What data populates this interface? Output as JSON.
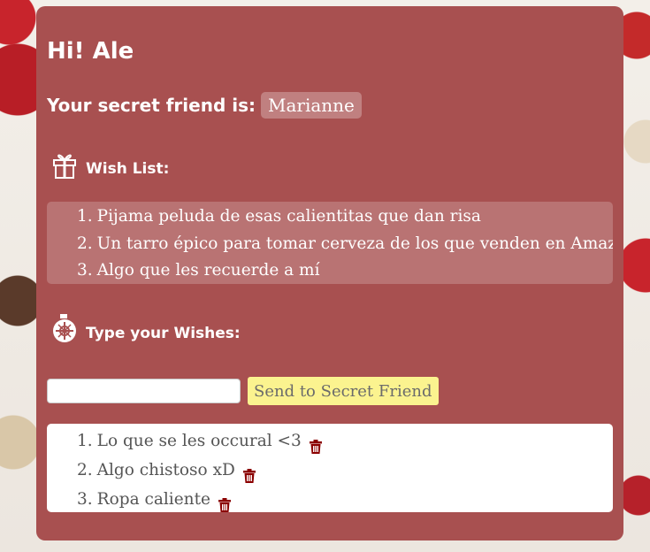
{
  "greeting": "Hi! Ale",
  "secret_friend": {
    "label": "Your secret friend is:",
    "name": "Marianne"
  },
  "wish_list": {
    "icon": "gift-icon",
    "title": "Wish List:",
    "items": [
      {
        "num": "1.",
        "text": "Pijama peluda de esas calientitas que dan risa"
      },
      {
        "num": "2.",
        "text": "Un tarro épico para tomar cerveza de los que venden en Amazon"
      },
      {
        "num": "3.",
        "text": "Algo que les recuerde a mí"
      }
    ]
  },
  "type_wishes": {
    "icon": "ornament-icon",
    "title": "Type your Wishes:",
    "input_value": "",
    "input_placeholder": "",
    "send_label": "Send to Secret Friend"
  },
  "my_wishes": {
    "items": [
      {
        "num": "1.",
        "text": "Lo que se les occural <3"
      },
      {
        "num": "2.",
        "text": "Algo chistoso xD"
      },
      {
        "num": "3.",
        "text": "Ropa caliente"
      }
    ],
    "delete_icon": "trash-icon"
  },
  "colors": {
    "card_background": "#a85050",
    "send_button": "#fbf38f",
    "trash_icon": "#8b0000"
  }
}
